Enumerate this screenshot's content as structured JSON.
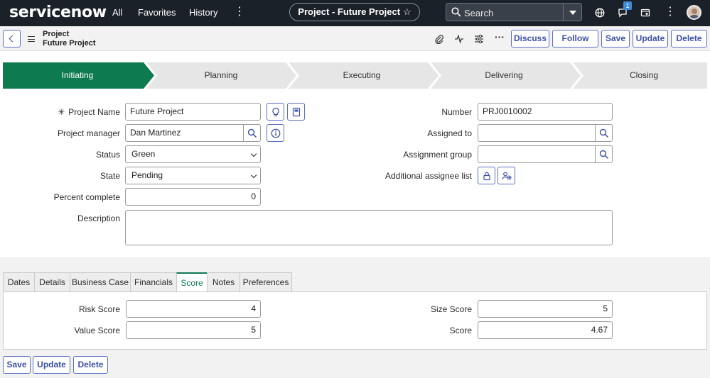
{
  "topbar": {
    "logo": "servicenow",
    "nav": [
      "All",
      "Favorites",
      "History"
    ],
    "record_pill": "Project - Future Project",
    "search_label": "Search",
    "notification_count": "1"
  },
  "header": {
    "record_type": "Project",
    "record_name": "Future Project",
    "buttons": {
      "discuss": "Discuss",
      "follow": "Follow",
      "save": "Save",
      "update": "Update",
      "delete": "Delete"
    }
  },
  "stages": [
    {
      "label": "Initiating",
      "active": true
    },
    {
      "label": "Planning",
      "active": false
    },
    {
      "label": "Executing",
      "active": false
    },
    {
      "label": "Delivering",
      "active": false
    },
    {
      "label": "Closing",
      "active": false
    }
  ],
  "form": {
    "required_mark": "✳",
    "project_name": {
      "label": "Project Name",
      "value": "Future Project"
    },
    "project_manager": {
      "label": "Project manager",
      "value": "Dan Martinez"
    },
    "status": {
      "label": "Status",
      "value": "Green"
    },
    "state": {
      "label": "State",
      "value": "Pending"
    },
    "percent_complete": {
      "label": "Percent complete",
      "value": "0"
    },
    "description": {
      "label": "Description",
      "value": ""
    },
    "number": {
      "label": "Number",
      "value": "PRJ0010002"
    },
    "assigned_to": {
      "label": "Assigned to",
      "value": ""
    },
    "assignment_group": {
      "label": "Assignment group",
      "value": ""
    },
    "additional_assignee": {
      "label": "Additional assignee list"
    }
  },
  "tabs": [
    {
      "label": "Dates",
      "active": false
    },
    {
      "label": "Details",
      "active": false
    },
    {
      "label": "Business Case",
      "active": false
    },
    {
      "label": "Financials",
      "active": false
    },
    {
      "label": "Score",
      "active": true
    },
    {
      "label": "Notes",
      "active": false
    },
    {
      "label": "Preferences",
      "active": false
    }
  ],
  "score": {
    "risk_score": {
      "label": "Risk Score",
      "value": "4"
    },
    "value_score": {
      "label": "Value Score",
      "value": "5"
    },
    "size_score": {
      "label": "Size Score",
      "value": "5"
    },
    "score": {
      "label": "Score",
      "value": "4.67"
    }
  },
  "footer": {
    "save": "Save",
    "update": "Update",
    "delete": "Delete"
  },
  "colors": {
    "topbar": "#1b2129",
    "active_stage": "#0e7a50",
    "inactive_stage": "#e6e6e6",
    "button_text": "#3b4fa8"
  }
}
